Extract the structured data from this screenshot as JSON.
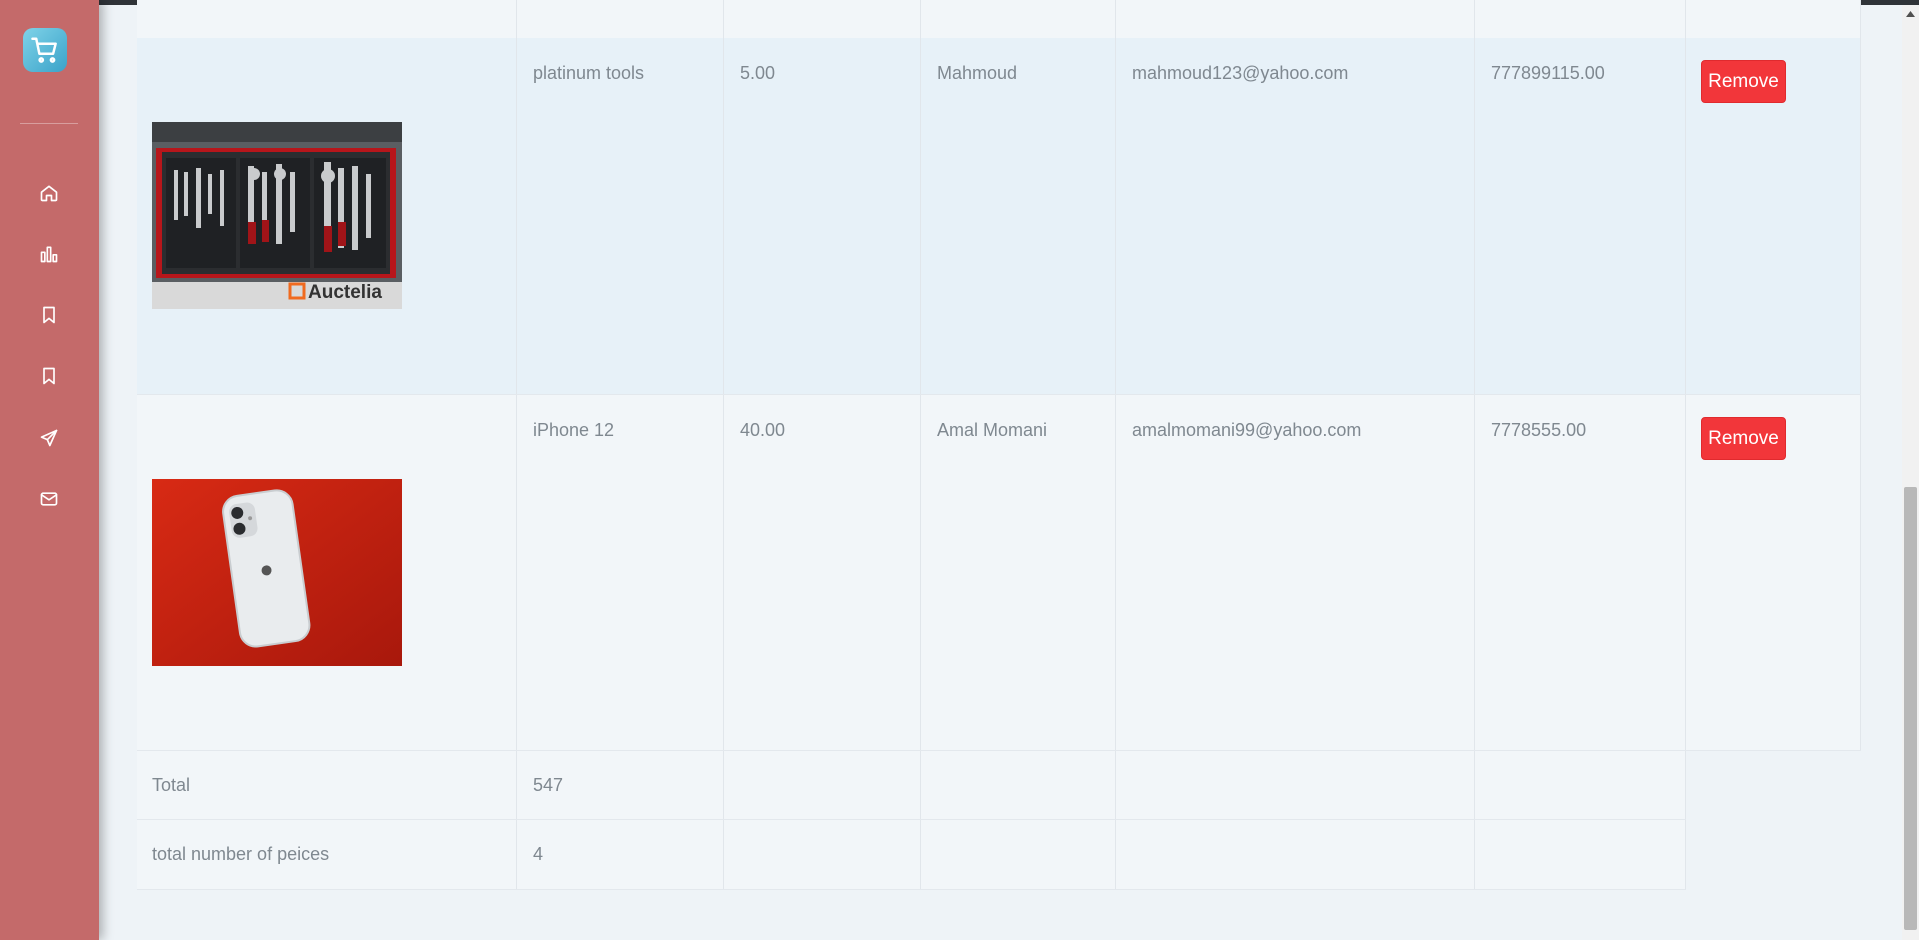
{
  "sidebar": {
    "logo_icon": "shopping-cart-icon",
    "nav": [
      {
        "icon": "home-icon"
      },
      {
        "icon": "bar-chart-icon"
      },
      {
        "icon": "bookmark-icon"
      },
      {
        "icon": "bookmark-icon"
      },
      {
        "icon": "send-icon"
      },
      {
        "icon": "mail-icon"
      }
    ],
    "color": "#c46a6a"
  },
  "table": {
    "rows": [
      {
        "image": "platinum tools in drawer (Auctelia)",
        "product": "platinum tools",
        "price": "5.00",
        "name": "Mahmoud",
        "email": "mahmoud123@yahoo.com",
        "phone": "777899115.00",
        "action": "Remove"
      },
      {
        "image": "iPhone 12 on red background",
        "product": "iPhone 12",
        "price": "40.00",
        "name": "Amal Momani",
        "email": "amalmomani99@yahoo.com",
        "phone": "7778555.00",
        "action": "Remove"
      }
    ],
    "total_label": "Total",
    "total_value": "547",
    "count_label": "total number of peices",
    "count_value": "4",
    "watermark": "Auctelia"
  },
  "colors": {
    "remove_button": "#f2363a",
    "row_highlight": "#e7f1f8",
    "row_default": "#f2f6f9"
  }
}
